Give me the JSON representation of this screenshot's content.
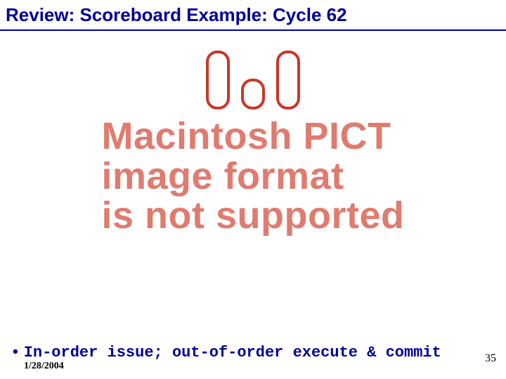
{
  "slide": {
    "title": "Review: Scoreboard Example: Cycle 62",
    "bullet": "In-order issue; out-of-order execute & commit",
    "date": "1/28/2004",
    "page_number": "35"
  },
  "figure": {
    "pict_message_lines": [
      "Macintosh PICT",
      "image format",
      "is not supported"
    ],
    "box_color": "#c9362a",
    "boxes": [
      "tall",
      "short",
      "tall"
    ]
  },
  "colors": {
    "title": "#000099",
    "pict_text": "#e07b6f",
    "underline": "#000099"
  }
}
